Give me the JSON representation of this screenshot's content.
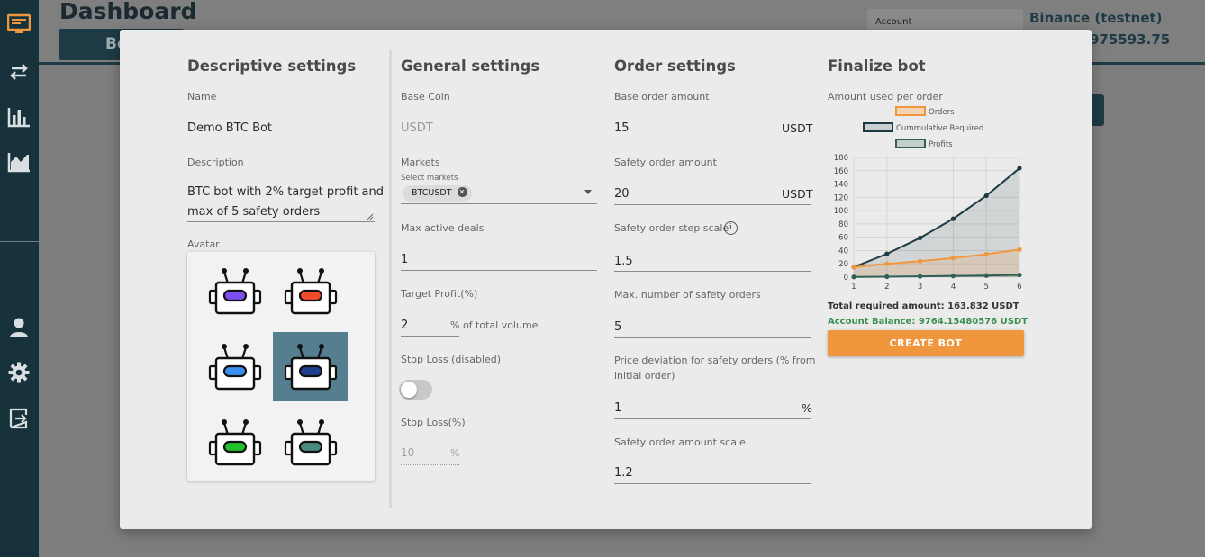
{
  "background": {
    "page_title": "Dashboard",
    "tab_label": "Bo",
    "account_label": "Account",
    "exchange": "Binance (testnet)",
    "balance": "975593.75"
  },
  "sidebar": {
    "icons": [
      "dashboard-icon",
      "exchange-arrows-icon",
      "bar-chart-icon",
      "area-chart-icon",
      "user-icon",
      "gear-icon",
      "logout-icon"
    ],
    "active_color": "#f0973d"
  },
  "descriptive": {
    "title": "Descriptive settings",
    "name_label": "Name",
    "name_value": "Demo BTC Bot",
    "description_label": "Description",
    "description_line1": "BTC bot with 2% target profit and",
    "description_line2": "max of 5 safety orders",
    "avatar_label": "Avatar",
    "avatars": [
      {
        "color": "#7b4ff0"
      },
      {
        "color": "#f04b28"
      },
      {
        "color": "#3b8ef0"
      },
      {
        "color": "#1d3f8c",
        "selected": true
      },
      {
        "color": "#22c02a"
      },
      {
        "color": "#4a8a7c"
      }
    ]
  },
  "general": {
    "title": "General settings",
    "base_coin_label": "Base Coin",
    "base_coin_value": "USDT",
    "markets_label": "Markets",
    "select_markets_label": "Select markets",
    "market_chip": "BTCUSDT",
    "max_active_deals_label": "Max active deals",
    "max_active_deals_value": "1",
    "target_profit_label": "Target Profit(%)",
    "target_profit_value": "2",
    "target_profit_suffix": "% of total volume",
    "stop_loss_toggle_label": "Stop Loss (disabled)",
    "stop_loss_label": "Stop Loss(%)",
    "stop_loss_value": "10",
    "stop_loss_suffix": "%"
  },
  "order": {
    "title": "Order settings",
    "base_order_label": "Base order amount",
    "base_order_value": "15",
    "base_order_unit": "USDT",
    "safety_order_label": "Safety order amount",
    "safety_order_value": "20",
    "safety_order_unit": "USDT",
    "step_scale_label": "Safety order step scale",
    "step_scale_value": "1.5",
    "max_safety_label": "Max. number of safety orders",
    "max_safety_value": "5",
    "price_dev_label_line1": "Price deviation for safety orders (% from",
    "price_dev_label_line2": "initial order)",
    "price_dev_value": "1",
    "price_dev_unit": "%",
    "amount_scale_label": "Safety order amount scale",
    "amount_scale_value": "1.2"
  },
  "finalize": {
    "title": "Finalize bot",
    "chart_caption": "Amount used per order",
    "total_required": "Total required amount: 163.832 USDT",
    "account_balance": "Account Balance: 9764.15480576 USDT",
    "create_button": "CREATE BOT",
    "balance_color": "#3a8f4e"
  },
  "chart_data": {
    "type": "line",
    "x": [
      1,
      2,
      3,
      4,
      5,
      6
    ],
    "ylim": [
      0,
      180
    ],
    "yticks": [
      0,
      20,
      40,
      60,
      80,
      100,
      120,
      140,
      160,
      180
    ],
    "grid": true,
    "legend_position": "top",
    "series": [
      {
        "name": "Orders",
        "color": "#f0973d",
        "values": [
          15,
          20,
          24,
          28.8,
          34.6,
          41.5
        ]
      },
      {
        "name": "Cummulative Required",
        "color": "#1e3a44",
        "values": [
          15,
          35,
          59,
          87.8,
          122.4,
          163.8
        ]
      },
      {
        "name": "Profits",
        "color": "#2f5f57",
        "values": [
          0.3,
          0.7,
          1.2,
          1.8,
          2.4,
          3.3
        ]
      }
    ]
  }
}
